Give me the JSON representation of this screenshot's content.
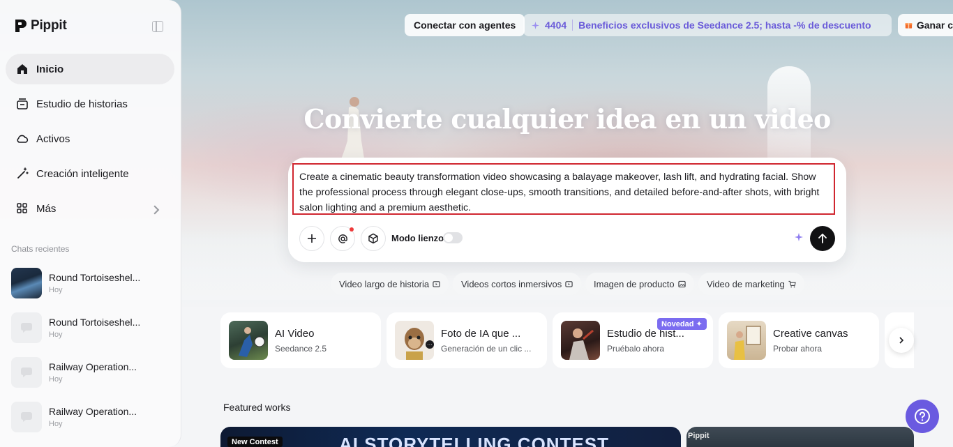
{
  "brand": {
    "name": "Pippit"
  },
  "sidebar": {
    "nav": [
      {
        "label": "Inicio",
        "icon": "home-icon",
        "active": true
      },
      {
        "label": "Estudio de historias",
        "icon": "story-studio-icon"
      },
      {
        "label": "Activos",
        "icon": "cloud-icon"
      },
      {
        "label": "Creación inteligente",
        "icon": "magic-wand-icon"
      },
      {
        "label": "Más",
        "icon": "grid-icon"
      }
    ],
    "recent_title": "Chats recientes",
    "chats": [
      {
        "title": "Round Tortoiseshel...",
        "time": "Hoy"
      },
      {
        "title": "Round Tortoiseshel...",
        "time": "Hoy"
      },
      {
        "title": "Railway Operation...",
        "time": "Hoy"
      },
      {
        "title": "Railway Operation...",
        "time": "Hoy"
      }
    ]
  },
  "topbar": {
    "connect_label": "Conectar con agentes",
    "promo_count": "4404",
    "promo_text": "Beneficios exclusivos de Seedance 2.5; hasta -% de descuento",
    "earn_label": "Ganar c"
  },
  "headline": "Convierte cualquier idea en un video",
  "prompt": {
    "text": "Create a cinematic beauty transformation video showcasing a balayage makeover, lash lift, and hydrating facial. Show the professional process through elegant close-ups, smooth transitions, and detailed before-and-after shots, with bright salon lighting and a premium aesthetic.",
    "canvas_mode_label": "Modo lienzo",
    "canvas_mode_on": false
  },
  "chips": [
    {
      "label": "Video largo de historia",
      "icon": "video-icon"
    },
    {
      "label": "Videos cortos inmersivos",
      "icon": "video-icon"
    },
    {
      "label": "Imagen de producto",
      "icon": "image-icon"
    },
    {
      "label": "Video de marketing",
      "icon": "cart-icon"
    }
  ],
  "features": [
    {
      "title": "AI Video",
      "subtitle": "Seedance 2.5"
    },
    {
      "title": "Foto de IA que ...",
      "subtitle": "Generación de un clic ..."
    },
    {
      "title": "Estudio de hist...",
      "subtitle": "Pruébalo ahora",
      "badge": "Novedad ✦"
    },
    {
      "title": "Creative canvas",
      "subtitle": "Probar ahora"
    }
  ],
  "featured": {
    "title": "Featured works",
    "contest_badge": "New Contest",
    "contest_title": "AI STORYTELLING CONTEST",
    "second_brand": "Pippit"
  },
  "colors": {
    "accent": "#6a5ae0",
    "highlight_border": "#d0262f",
    "send": "#111113"
  }
}
